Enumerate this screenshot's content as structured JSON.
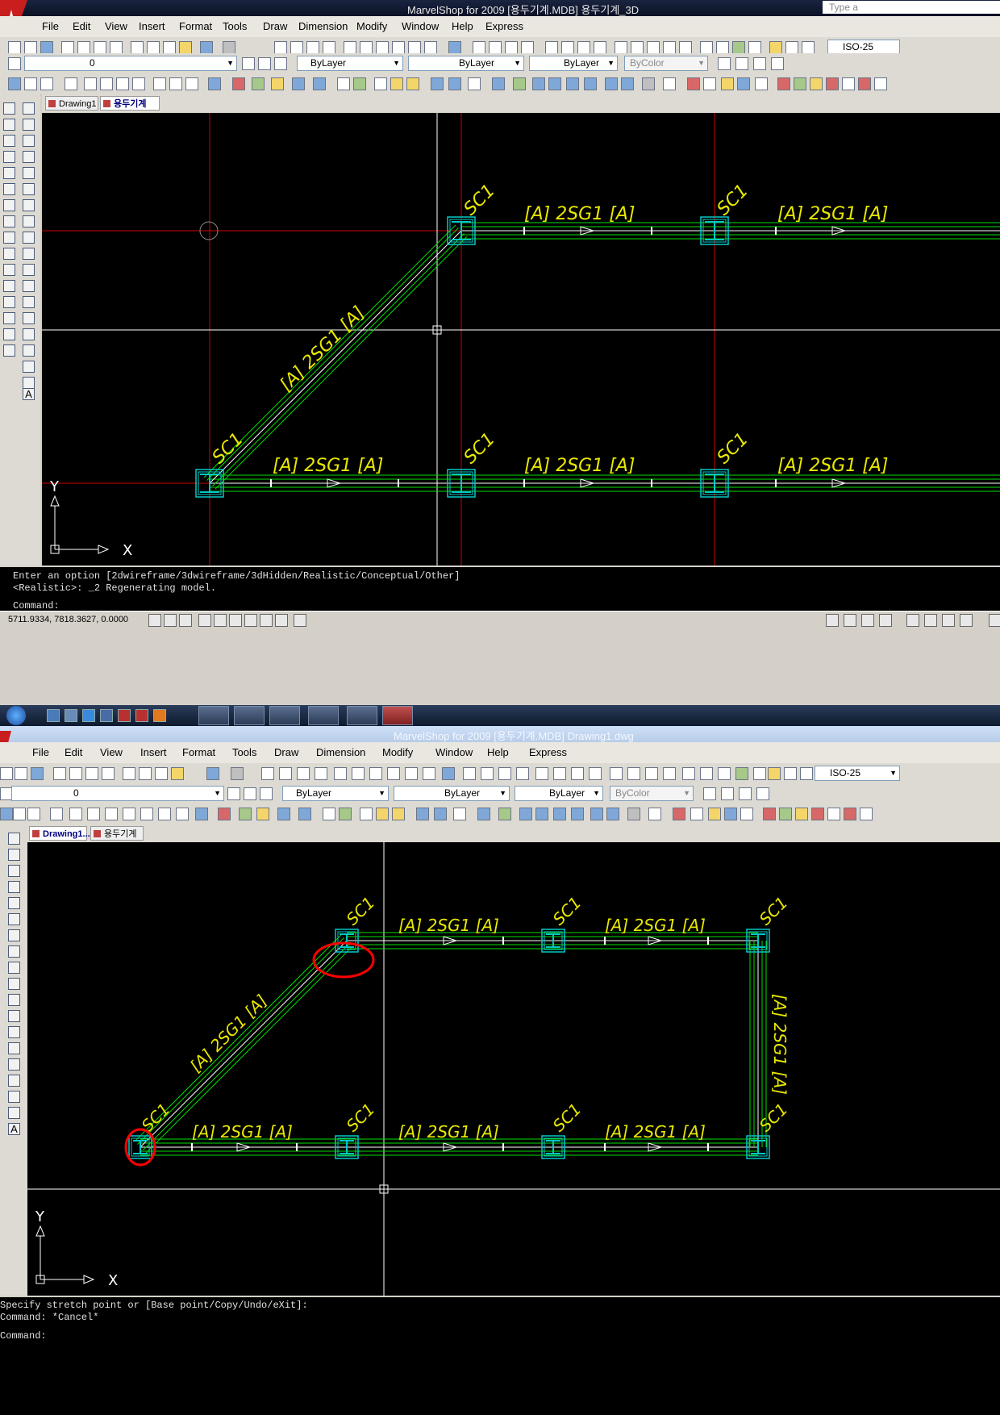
{
  "top_window": {
    "title": "MarvelShop for 2009  [용두기계.MDB] 용두기계_3D",
    "search_placeholder": "Type a",
    "menu": [
      "File",
      "Edit",
      "View",
      "Insert",
      "Format",
      "Tools",
      "Draw",
      "Dimension",
      "Modify",
      "Window",
      "Help",
      "Express"
    ],
    "layer_value": "0",
    "color_value": "ByLayer",
    "linetype_value": "ByLayer",
    "lineweight_value": "ByLayer",
    "plotstyle_value": "ByColor",
    "dimstyle_value": "ISO-25",
    "tabs": [
      "Drawing1",
      "용두기계"
    ],
    "active_tab": 1,
    "axis": {
      "y": "Y",
      "x": "X"
    },
    "labels": {
      "sc": "SC1",
      "beam": "[A]  2SG1  [A]",
      "beam_partial": "[A"
    },
    "command_lines": [
      "Enter an option [2dwireframe/3dwireframe/3dHidden/Realistic/Conceptual/Other]",
      "<Realistic>: _2 Regenerating model.",
      "Command:"
    ],
    "coordinates": "5711.9334, 7818.3627, 0.0000"
  },
  "bottom_window": {
    "title": "MarvelShop for 2009  [용두기계.MDB] Drawing1.dwg",
    "menu": [
      "File",
      "Edit",
      "View",
      "Insert",
      "Format",
      "Tools",
      "Draw",
      "Dimension",
      "Modify",
      "Window",
      "Help",
      "Express"
    ],
    "layer_value": "0",
    "color_value": "ByLayer",
    "linetype_value": "ByLayer",
    "lineweight_value": "ByLayer",
    "plotstyle_value": "ByColor",
    "dimstyle_value": "ISO-25",
    "tabs": [
      "Drawing1...",
      "용두기계"
    ],
    "active_tab": 0,
    "axis": {
      "y": "Y",
      "x": "X"
    },
    "labels": {
      "sc": "SC1",
      "beam": "[A]  2SG1  [A]"
    },
    "command_lines": [
      "Specify stretch point or [Base point/Copy/Undo/eXit]:",
      "Command: *Cancel*",
      "Command:"
    ]
  },
  "colors": {
    "canvas": "#000000",
    "beam": "#00e000",
    "column": "#00c8c8",
    "label": "#e8e800",
    "grid": "#d00000",
    "crosshair": "#ffffff",
    "markup": "#ff0000"
  }
}
